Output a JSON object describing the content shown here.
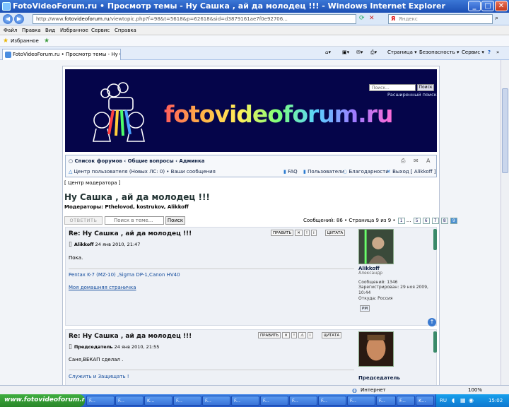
{
  "window": {
    "title": "FotoVideoForum.ru • Просмотр темы - Ну Сашка , ай да молодец !!! - Windows Internet Explorer",
    "minimize": "_",
    "maximize": "□",
    "close": "✕"
  },
  "addressbar": {
    "back": "◀",
    "forward": "▶",
    "url_prefix": "http://www.",
    "url_host": "fotovideoforum.ru",
    "url_rest": "/viewtopic.php?f=98&t=5618&p=62618&sid=d3879161ae7f0e92706...",
    "search_engine": "Я",
    "search_placeholder": "Яндекс"
  },
  "menu": [
    "Файл",
    "Правка",
    "Вид",
    "Избранное",
    "Сервис",
    "Справка"
  ],
  "favorites": {
    "label": "Избранное"
  },
  "tab": {
    "label": "FotoVideoForum.ru • Просмотр темы - Ну С..."
  },
  "toolbar": {
    "page": "Страница ▾",
    "safety": "Безопасность ▾",
    "tools": "Сервис ▾",
    "help": "?"
  },
  "banner": {
    "logo": "fotovideoforum.ru",
    "search_placeholder": "Поиск...",
    "search_button": "Поиск",
    "advanced": "Расширенный поиск"
  },
  "nav": {
    "breadcrumb": "Список форумов ‹ Общие вопросы ‹ Админка",
    "ucp": "Центр пользователя (Новых ЛС: 0) • Ваши сообщения",
    "faq": "FAQ",
    "members": "Пользователи",
    "thanks": "Благодарности",
    "logout": "Выход [ Alikkoff ]",
    "modcp": "[ Центр модератора ]"
  },
  "topic": {
    "title": "Ну Сашка , ай да молодец !!!",
    "moderators": "Модераторы: Pthelovod, kostrukov, Alikkoff",
    "reply_button": "ОТВЕТИТЬ",
    "search_placeholder": "Поиск в теме...",
    "search_button": "Поиск",
    "pagination": "Сообщений: 86 • Страница 9 из 9 •",
    "pages": [
      "1",
      "...",
      "5",
      "6",
      "7",
      "8",
      "9"
    ]
  },
  "posts": [
    {
      "title": "Re: Ну Сашка , ай да молодец !!!",
      "author": "Alikkoff",
      "date": "24 янв 2010, 21:47",
      "text": "Пока.",
      "signature": "Pentax K-7 (MZ-10) ,Sigma DP-1,Canon HV40",
      "link": "Моя домашняя страничка",
      "buttons": {
        "edit": "ПРАВИТЬ",
        "quote": "ЦИТАТА"
      },
      "user": {
        "name": "Alikkoff",
        "realname": "Александр",
        "posts": "Сообщений: 1346",
        "registered": "Зарегистрирован: 29 ноя 2009, 10:44",
        "from": "Откуда: Россия",
        "pm": "PM"
      }
    },
    {
      "title": "Re: Ну Сашка , ай да молодец !!!",
      "author": "Председатель",
      "date": "24 янв 2010, 21:55",
      "text": "Саня,ВЕКАП сделал .",
      "signature": "Служить и Защищать !",
      "buttons": {
        "edit": "ПРАВИТЬ",
        "quote": "ЦИТАТА"
      },
      "user": {
        "name": "Председатель"
      }
    }
  ],
  "status": {
    "zone": "Интернет",
    "zoom": "100%"
  },
  "taskbar": {
    "start": "www.fotovideoforum.ru",
    "buttons": [
      "F...",
      "F...",
      "K...",
      "F...",
      "F...",
      "F...",
      "F...",
      "F...",
      "F...",
      "F...",
      "F...",
      "F...",
      "K..."
    ],
    "lang": "RU",
    "clock": "15:02"
  }
}
